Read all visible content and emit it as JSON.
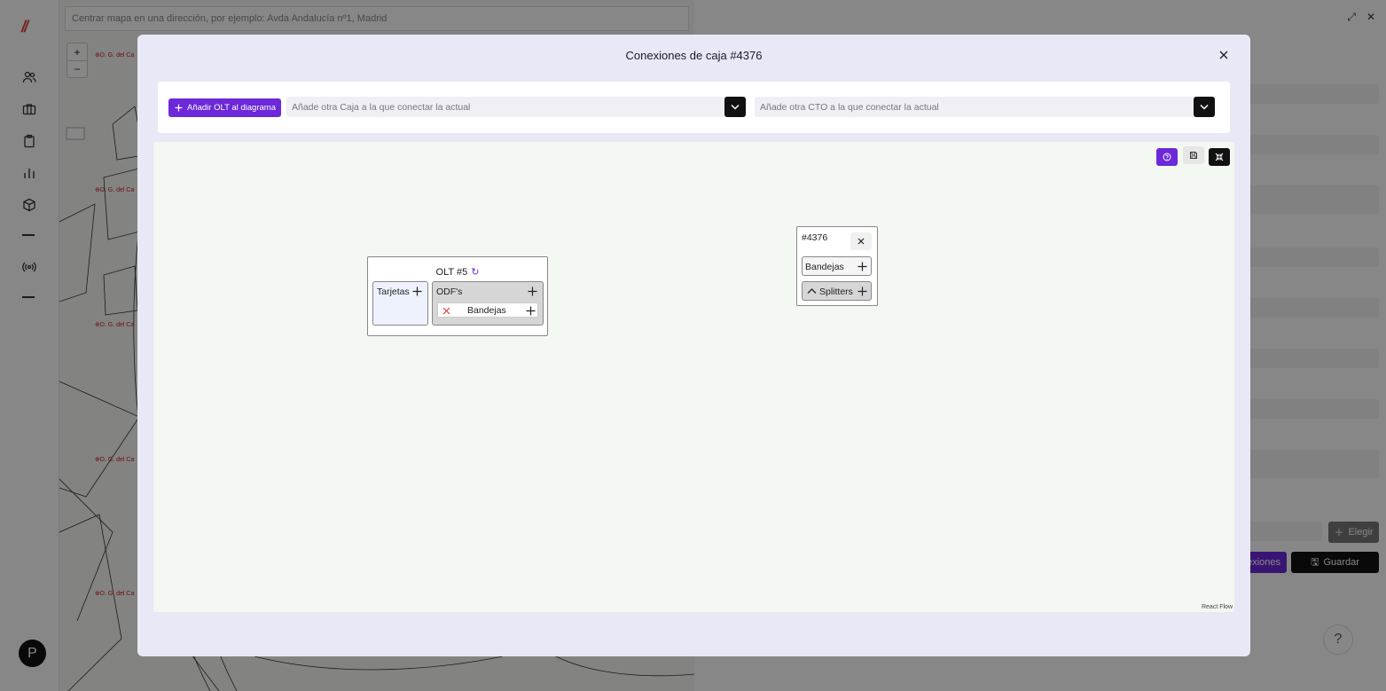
{
  "app": {
    "map_search_placeholder": "Centrar mapa en una dirección, por ejemplo: Avda Andalucía nº1, Madrid",
    "zoom_in": "+",
    "zoom_out": "−",
    "map_labels": [
      "⊕D. G. del Ca",
      "⊕D. G. del Ca",
      "⊕D. G. del Ca",
      "⊕D. G. del Ca",
      "⊕D. G. del Ca"
    ],
    "avatar_initial": "P",
    "elegir_label": "Elegir",
    "conexiones_label": "exiones",
    "guardar_label": "Guardar",
    "help_label": "?"
  },
  "modal": {
    "title": "Conexiones de caja #4376",
    "add_olt_label": "Añadir OLT al diagrama",
    "caja_placeholder": "Añade otra Caja a la que conectar la actual",
    "cto_placeholder": "Añade otra CTO a la que conectar la actual",
    "attribution": "React Flow"
  },
  "diagram": {
    "olt_node": {
      "title": "OLT #5",
      "tarjetas_label": "Tarjetas",
      "odfs_label": "ODF's",
      "bandejas_label": "Bandejas"
    },
    "box_node": {
      "title": "#4376",
      "bandejas_label": "Bandejas",
      "splitters_label": "Splitters"
    }
  },
  "colors": {
    "accent": "#6d28d9",
    "canvas_bg": "#f3f8f2",
    "modal_bg": "#e8e8f6",
    "remove_red": "#e53935"
  }
}
